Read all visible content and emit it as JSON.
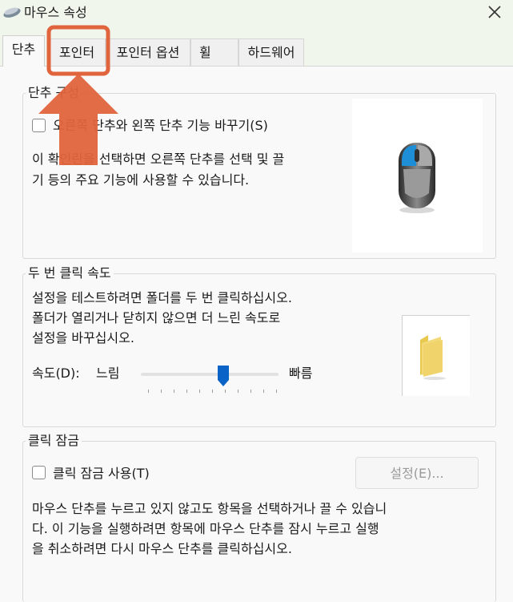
{
  "window": {
    "title": "마우스 속성",
    "mouse_icon": "mouse-icon",
    "close_icon": "close-icon"
  },
  "tabs": [
    {
      "label": "단추",
      "active": true
    },
    {
      "label": "포인터",
      "active": false
    },
    {
      "label": "포인터 옵션",
      "active": false
    },
    {
      "label": "휠",
      "active": false
    },
    {
      "label": "하드웨어",
      "active": false
    }
  ],
  "button_config": {
    "legend": "단추 구성",
    "switch_checkbox_label": "오른쪽 단추와 왼쪽 단추 기능 바꾸기(S)",
    "switch_checked": false,
    "description_line1": "이 확인란을 선택하면 오른쪽 단추를 선택 및 끌",
    "description_line2": "기 등의 주요 기능에 사용할 수 있습니다."
  },
  "double_click": {
    "legend": "두 번 클릭 속도",
    "description_line1": "설정을 테스트하려면 폴더를 두 번 클릭하십시오.",
    "description_line2": "폴더가 열리거나 닫히지 않으면 더 느린 속도로",
    "description_line3": "설정을 바꾸십시오.",
    "speed_label": "속도(D):",
    "slow_label": "느림",
    "fast_label": "빠름",
    "speed_fraction": 0.6,
    "folder_icon": "folder-icon"
  },
  "click_lock": {
    "legend": "클릭 잠금",
    "checkbox_label": "클릭 잠금 사용(T)",
    "checked": false,
    "settings_button": "설정(E)...",
    "description_line1": "마우스 단추를 누르고 있지 않고도 항목을 선택하거나 끌 수 있습니",
    "description_line2": "다. 이 기능을 실행하려면 항목에 마우스 단추를 잠시 누르고 실행",
    "description_line3": "을 취소하려면 다시 마우스 단추를 클릭하십시오."
  },
  "annotation": {
    "color": "#e0643c",
    "target": "포인터"
  }
}
